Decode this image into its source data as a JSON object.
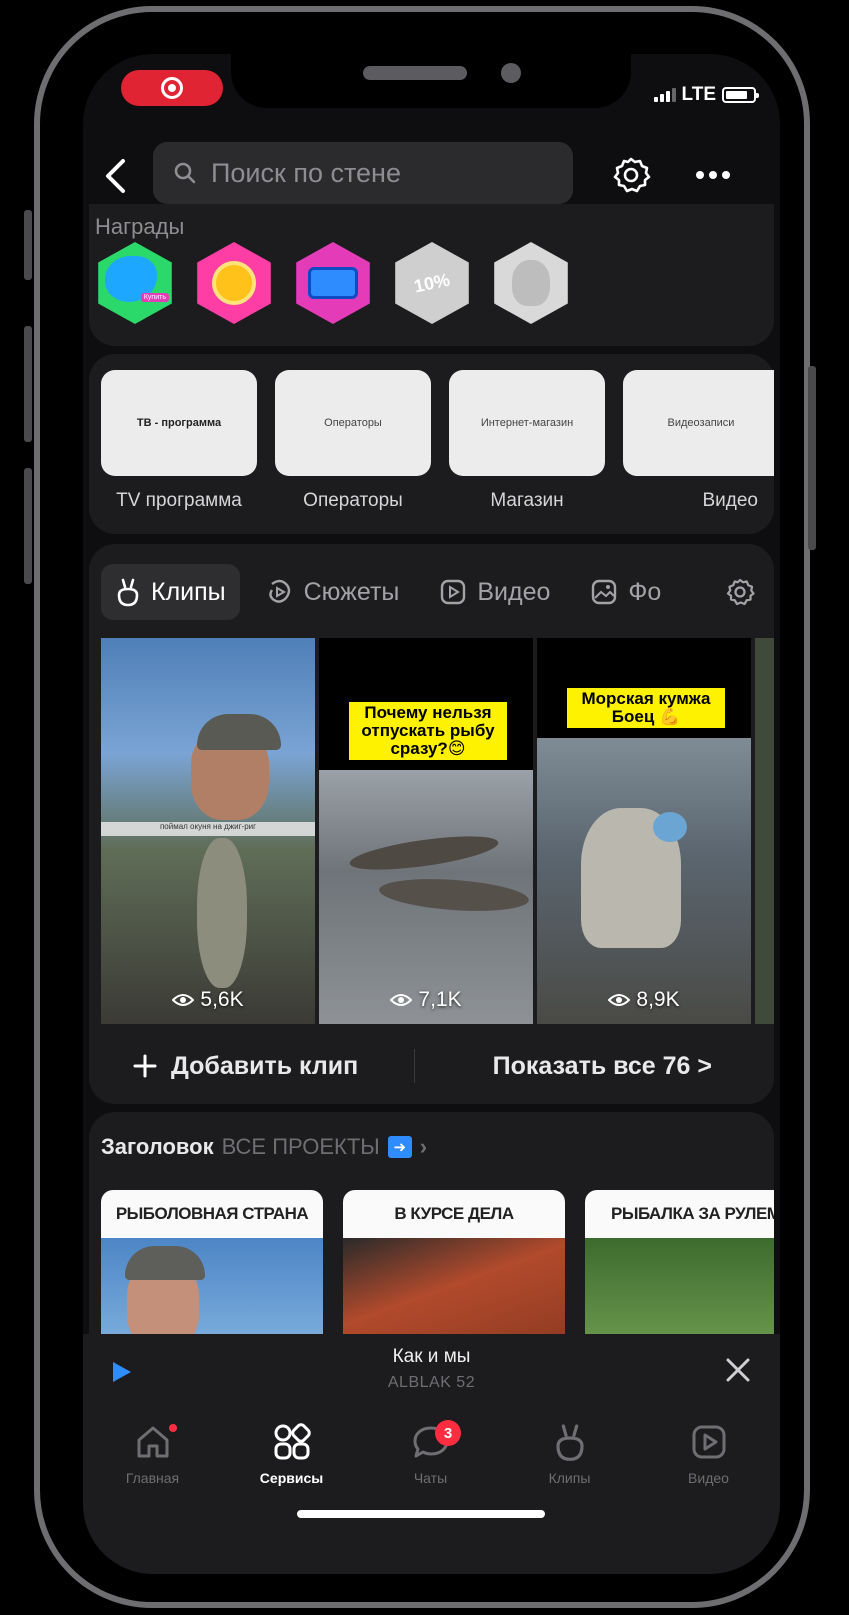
{
  "status_bar": {
    "network": "LTE"
  },
  "header": {
    "search_placeholder": "Поиск по стене"
  },
  "awards": {
    "title": "Награды",
    "items": [
      {
        "label": "Купить",
        "color": "#2bd96a"
      },
      {
        "label": "",
        "color": "#ff3ea5"
      },
      {
        "label": "",
        "color": "#e43bb8"
      },
      {
        "label": "10%",
        "color": "#cfcfcf"
      },
      {
        "label": "",
        "color": "#d9d9d9"
      }
    ]
  },
  "services": [
    {
      "tile": "ТВ - программа",
      "label": "TV программа"
    },
    {
      "tile": "Операторы",
      "label": "Операторы"
    },
    {
      "tile": "Интернет-магазин",
      "label": "Магазин"
    },
    {
      "tile": "Видеозаписи",
      "label": "Видео"
    }
  ],
  "clips": {
    "tabs": [
      "Клипы",
      "Сюжеты",
      "Видео",
      "Фо"
    ],
    "items": [
      {
        "caption": "",
        "subcaption": "поймал окуня на джиг-риг",
        "views": "5,6K"
      },
      {
        "caption": "Почему нельзя отпускать рыбу сразу?😊",
        "subcaption": "",
        "views": "7,1K"
      },
      {
        "caption": "Морская кумжа Боец 💪",
        "subcaption": "",
        "views": "8,9K"
      }
    ],
    "add_label": "Добавить клип",
    "show_all_label": "Показать все 76 >"
  },
  "projects": {
    "title": "Заголовок",
    "subtitle": "ВСЕ ПРОЕКТЫ",
    "items": [
      {
        "title": "РЫБОЛОВНАЯ СТРАНА"
      },
      {
        "title": "В КУРСЕ ДЕЛА"
      },
      {
        "title": "РЫБАЛКА ЗА РУЛЕМ"
      }
    ]
  },
  "player": {
    "title": "Как и мы",
    "artist": "ALBLAK 52"
  },
  "tabbar": {
    "items": [
      {
        "label": "Главная"
      },
      {
        "label": "Сервисы"
      },
      {
        "label": "Чаты",
        "badge": "3"
      },
      {
        "label": "Клипы"
      },
      {
        "label": "Видео"
      }
    ]
  },
  "colors": {
    "accent_red": "#e02433",
    "badge_red": "#ff2d3f",
    "play_blue": "#2f8cff",
    "caption_yellow": "#fff200"
  }
}
